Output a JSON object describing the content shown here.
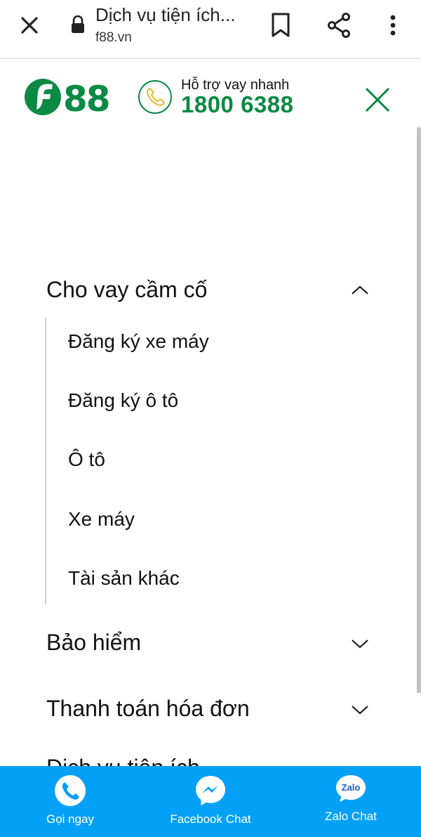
{
  "browser": {
    "title": "Dịch vụ tiện ích...",
    "url": "f88.vn",
    "icons": {
      "close": "close-icon",
      "lock": "lock-icon",
      "bookmark": "bookmark-icon",
      "share": "share-icon",
      "more": "more-vert-icon"
    }
  },
  "header": {
    "logo_text": "F88",
    "hotline_label": "Hỗ trợ vay nhanh",
    "hotline_number": "1800 6388",
    "colors": {
      "brand_green": "#0a8a43",
      "phone_accent": "#e8b92c"
    }
  },
  "menu": {
    "groups": [
      {
        "label": "Cho vay cầm cố",
        "expanded": true,
        "items": [
          {
            "label": "Đăng ký xe máy"
          },
          {
            "label": "Đăng ký ô tô"
          },
          {
            "label": "Ô tô"
          },
          {
            "label": "Xe máy"
          },
          {
            "label": "Tài sản khác"
          }
        ]
      },
      {
        "label": "Bảo hiểm",
        "expanded": false
      },
      {
        "label": "Thanh toán hóa đơn",
        "expanded": false
      }
    ],
    "clipped_item": "Dịch vụ tiện ích"
  },
  "contact_bar": {
    "color": "#03a0f8",
    "items": [
      {
        "label": "Gọi ngay",
        "icon": "phone-icon"
      },
      {
        "label": "Facebook Chat",
        "icon": "messenger-icon"
      },
      {
        "label": "Zalo Chat",
        "icon": "zalo-icon",
        "icon_text": "Zalo"
      }
    ]
  }
}
